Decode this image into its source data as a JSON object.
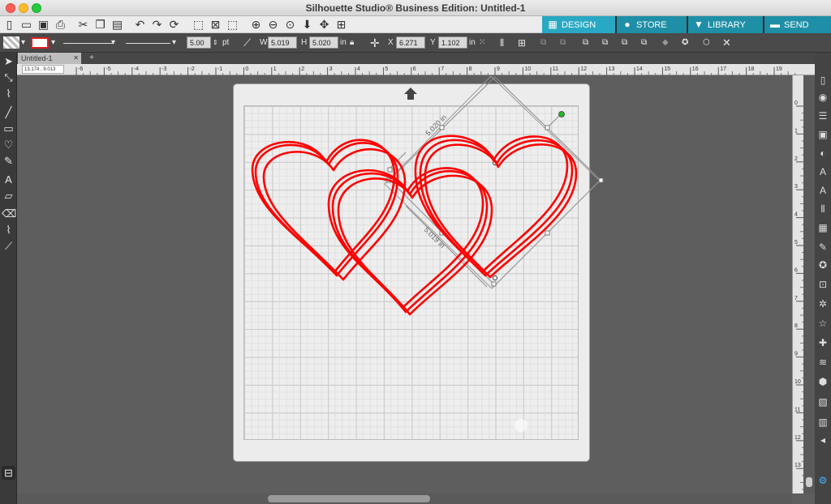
{
  "window": {
    "title": "Silhouette Studio® Business Edition: Untitled-1"
  },
  "main_toolbar": {
    "icons": [
      "new-doc-icon",
      "open-folder-icon",
      "save-icon",
      "print-icon",
      "cut-icon",
      "copy-icon",
      "paste-icon",
      "undo-icon",
      "redo-icon",
      "refresh-icon",
      "select-all-icon",
      "deselect-icon",
      "draw-mode-icon",
      "zoom-in-icon",
      "zoom-out-icon",
      "zoom-select-icon",
      "move-down-icon",
      "pan-icon",
      "fit-page-icon"
    ]
  },
  "nav_tabs": {
    "design": "DESIGN",
    "store": "STORE",
    "library": "LIBRARY",
    "send": "SEND"
  },
  "properties": {
    "line_width": "5.00",
    "line_width_unit": "pt",
    "w_label": "W",
    "w_value": "5.019",
    "h_label": "H",
    "h_value": "5.020",
    "size_unit": "in",
    "x_label": "X",
    "x_value": "6.271",
    "y_label": "Y",
    "y_value": "1.102",
    "pos_unit": "in"
  },
  "document": {
    "tab": "Untitled-1",
    "add_tab": "+"
  },
  "ruler": {
    "corner": "13.174 , 9.013",
    "h_ticks": [
      "-6",
      "-5",
      "-4",
      "-3",
      "-2",
      "-1",
      "0",
      "1",
      "2",
      "3",
      "4",
      "5",
      "6",
      "7",
      "8",
      "9",
      "10",
      "11",
      "12",
      "13",
      "14",
      "15",
      "16",
      "17",
      "18",
      "19"
    ],
    "v_ticks": [
      "0",
      "1",
      "2",
      "3",
      "4",
      "5",
      "6",
      "7",
      "8",
      "9",
      "10",
      "11",
      "12",
      "13"
    ]
  },
  "canvas": {
    "width_dimension": "5.020 in",
    "height_dimension": "5.019 in",
    "stroke_color": "#ff0000",
    "rotate_handle_color": "#22bb22"
  },
  "colors": {
    "design_tab": "#29a8c4",
    "other_tabs": "#1e8fa6",
    "toolbar": "#4a4a4a"
  }
}
